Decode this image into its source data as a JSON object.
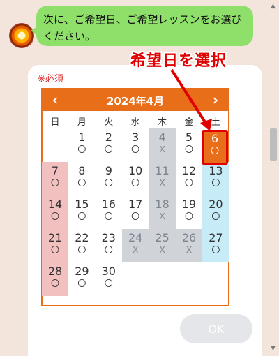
{
  "chat": {
    "message": "次に、ご希望日、ご希望レッスンをお選びください。"
  },
  "form": {
    "required_label": "※必須"
  },
  "calendar": {
    "title": "2024年4月",
    "prev_icon": "‹",
    "next_icon": "›",
    "weekdays": [
      "日",
      "月",
      "火",
      "水",
      "木",
      "金",
      "土"
    ],
    "colors": {
      "header": "#e86e1a",
      "sunday": "#f3c0c0",
      "saturday": "#c7ecf7",
      "unavailable": "#d0d3d8"
    },
    "days": [
      {
        "day": "1",
        "mark": "〇",
        "status": "available"
      },
      {
        "day": "2",
        "mark": "〇",
        "status": "available"
      },
      {
        "day": "3",
        "mark": "〇",
        "status": "available"
      },
      {
        "day": "4",
        "mark": "X",
        "status": "unavailable"
      },
      {
        "day": "5",
        "mark": "〇",
        "status": "available"
      },
      {
        "day": "6",
        "mark": "〇",
        "status": "selected"
      },
      {
        "day": "7",
        "mark": "〇",
        "status": "available"
      },
      {
        "day": "8",
        "mark": "〇",
        "status": "available"
      },
      {
        "day": "9",
        "mark": "〇",
        "status": "available"
      },
      {
        "day": "10",
        "mark": "〇",
        "status": "available"
      },
      {
        "day": "11",
        "mark": "X",
        "status": "unavailable"
      },
      {
        "day": "12",
        "mark": "〇",
        "status": "available"
      },
      {
        "day": "13",
        "mark": "〇",
        "status": "available"
      },
      {
        "day": "14",
        "mark": "〇",
        "status": "available"
      },
      {
        "day": "15",
        "mark": "〇",
        "status": "available"
      },
      {
        "day": "16",
        "mark": "〇",
        "status": "available"
      },
      {
        "day": "17",
        "mark": "〇",
        "status": "available"
      },
      {
        "day": "18",
        "mark": "X",
        "status": "unavailable"
      },
      {
        "day": "19",
        "mark": "〇",
        "status": "available"
      },
      {
        "day": "20",
        "mark": "〇",
        "status": "available"
      },
      {
        "day": "21",
        "mark": "〇",
        "status": "available"
      },
      {
        "day": "22",
        "mark": "〇",
        "status": "available"
      },
      {
        "day": "23",
        "mark": "〇",
        "status": "available"
      },
      {
        "day": "24",
        "mark": "X",
        "status": "unavailable"
      },
      {
        "day": "25",
        "mark": "X",
        "status": "unavailable"
      },
      {
        "day": "26",
        "mark": "X",
        "status": "unavailable"
      },
      {
        "day": "27",
        "mark": "〇",
        "status": "available"
      },
      {
        "day": "28",
        "mark": "〇",
        "status": "available"
      },
      {
        "day": "29",
        "mark": "〇",
        "status": "available"
      },
      {
        "day": "30",
        "mark": "〇",
        "status": "available"
      }
    ]
  },
  "annotation": {
    "text": "希望日を選択",
    "color": "#e10000"
  },
  "ok_button": {
    "label": "OK"
  }
}
